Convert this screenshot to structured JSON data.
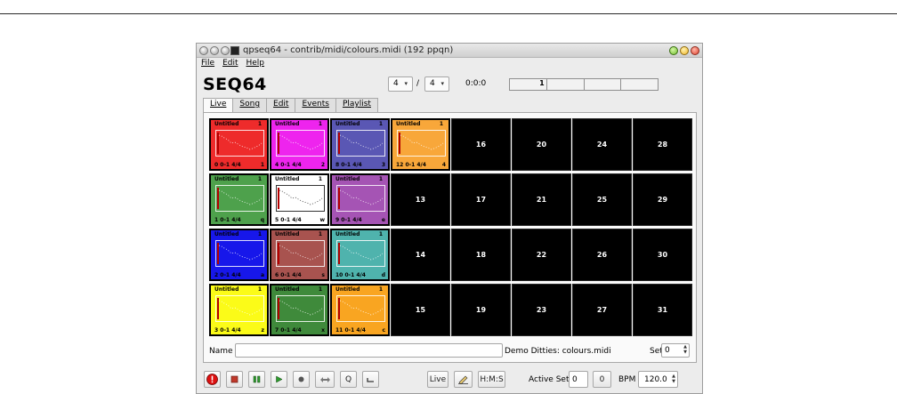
{
  "window": {
    "title": "qpseq64 - contrib/midi/colours.midi (192 ppqn)"
  },
  "menu": [
    {
      "label": "File",
      "name": "menu-file"
    },
    {
      "label": "Edit",
      "name": "menu-edit"
    },
    {
      "label": "Help",
      "name": "menu-help"
    }
  ],
  "header": {
    "app_name": "SEQ64",
    "beats_per_bar": "4",
    "beat_width": "4",
    "slash": "/",
    "clock": "0:0:0",
    "timeline": [
      "1",
      "",
      "",
      ""
    ]
  },
  "tabs": [
    {
      "label": "Live",
      "name": "tab-live",
      "active": true
    },
    {
      "label": "Song",
      "name": "tab-song"
    },
    {
      "label": "Edit",
      "name": "tab-edit"
    },
    {
      "label": "Events",
      "name": "tab-events"
    },
    {
      "label": "Playlist",
      "name": "tab-playlist"
    }
  ],
  "patterns": [
    {
      "slot": 0,
      "name": "Untitled",
      "num": "1",
      "info": "0  0-1 4/4",
      "key": "1",
      "bg": "#ee2b2b",
      "fg": "#000000"
    },
    {
      "slot": 1,
      "name": "Untitled",
      "num": "1",
      "info": "1  0-1 4/4",
      "key": "q",
      "bg": "#4ea14c",
      "fg": "#000000"
    },
    {
      "slot": 2,
      "name": "Untitled",
      "num": "1",
      "info": "2  0-1 4/4",
      "key": "a",
      "bg": "#1717ea",
      "fg": "#000000"
    },
    {
      "slot": 3,
      "name": "Untitled",
      "num": "1",
      "info": "3  0-1 4/4",
      "key": "z",
      "bg": "#fbfb18",
      "fg": "#000000"
    },
    {
      "slot": 4,
      "name": "Untitled",
      "num": "1",
      "info": "4  0-1 4/4",
      "key": "2",
      "bg": "#ee24ee",
      "fg": "#000000"
    },
    {
      "slot": 5,
      "name": "Untitled",
      "num": "1",
      "info": "5  0-1 4/4",
      "key": "w",
      "bg": "#ffffff",
      "fg": "#000000"
    },
    {
      "slot": 6,
      "name": "Untitled",
      "num": "1",
      "info": "6  0-1 4/4",
      "key": "s",
      "bg": "#a8534f",
      "fg": "#000000"
    },
    {
      "slot": 7,
      "name": "Untitled",
      "num": "1",
      "info": "7  0-1 4/4",
      "key": "x",
      "bg": "#3f8a3b",
      "fg": "#000000"
    },
    {
      "slot": 8,
      "name": "Untitled",
      "num": "1",
      "info": "8  0-1 4/4",
      "key": "3",
      "bg": "#5a57b4",
      "fg": "#000000"
    },
    {
      "slot": 9,
      "name": "Untitled",
      "num": "1",
      "info": "9  0-1 4/4",
      "key": "e",
      "bg": "#a554b4",
      "fg": "#000000"
    },
    {
      "slot": 10,
      "name": "Untitled",
      "num": "1",
      "info": "10  0-1 4/4",
      "key": "d",
      "bg": "#4fb3ad",
      "fg": "#000000"
    },
    {
      "slot": 11,
      "name": "Untitled",
      "num": "1",
      "info": "11  0-1 4/4",
      "key": "c",
      "bg": "#f9a521",
      "fg": "#000000"
    },
    {
      "slot": 12,
      "name": "Untitled",
      "num": "1",
      "info": "12  0-1 4/4",
      "key": "4",
      "bg": "#f8a73a",
      "fg": "#000000"
    }
  ],
  "empty_slots": [
    "13",
    "14",
    "15",
    "16",
    "17",
    "18",
    "19",
    "20",
    "21",
    "22",
    "23",
    "24",
    "25",
    "26",
    "27",
    "28",
    "29",
    "30",
    "31"
  ],
  "bottom": {
    "name_label": "Name",
    "name_value": "",
    "set_name": "Demo Ditties: colours.midi",
    "set_label": "Set",
    "set_value": "0"
  },
  "controls": {
    "panic_icon": "stop-circle-icon",
    "stop_icon": "square-stop-icon",
    "pause_icon": "pause-icon",
    "play_icon": "play-icon",
    "record_icon": "record-dot-icon",
    "loop_icon": "loop-arrows-icon",
    "q_label": "Q",
    "snap_icon": "bracket-icon",
    "live_label": "Live",
    "edit_icon": "pencil-icon",
    "hms_label": "H:M:S",
    "active_set_label": "Active Set",
    "active_set_value": "0",
    "active_set_count": "0",
    "bpm_label": "BPM",
    "bpm_value": "120.0"
  },
  "colors": {
    "panic_red": "#dd1111",
    "play_green": "#2d9a2d"
  }
}
